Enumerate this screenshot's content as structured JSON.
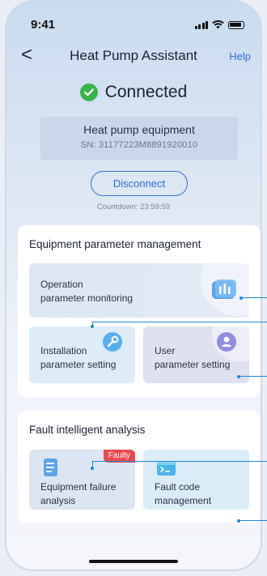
{
  "status_bar": {
    "time": "9:41"
  },
  "nav": {
    "back": "<",
    "title": "Heat Pump Assistant",
    "help": "Help"
  },
  "connection": {
    "status": "Connected"
  },
  "device": {
    "name": "Heat pump equipment",
    "sn": "SN: 31177223M8891920010"
  },
  "disconnect_label": "Disconnect",
  "countdown": "Countdown: 23:59:59",
  "equipment_section": {
    "title": "Equipment parameter management",
    "monitoring": {
      "line1": "Operation",
      "line2": "parameter monitoring",
      "icon": "chart-bars-icon"
    },
    "installation": {
      "line1": "Installation",
      "line2": "parameter setting",
      "icon": "wrench-icon"
    },
    "user": {
      "line1": "User",
      "line2": "parameter setting",
      "icon": "user-icon"
    }
  },
  "fault_section": {
    "title": "Fault intelligent analysis",
    "failure": {
      "line1": "Equipment failure",
      "line2": "analysis",
      "badge": "Faulty",
      "icon": "document-icon"
    },
    "code": {
      "line1": "Fault code",
      "line2": "management",
      "icon": "terminal-icon"
    }
  },
  "colors": {
    "accent": "#2f6fd8",
    "success": "#36b54a",
    "danger": "#e94a4f",
    "callout": "#1a8ad8"
  }
}
